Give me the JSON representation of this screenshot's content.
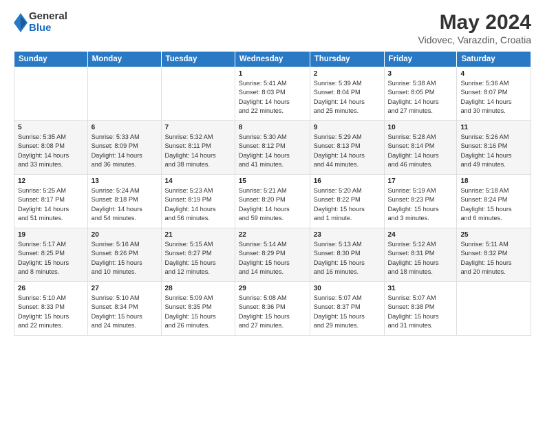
{
  "header": {
    "logo": {
      "general": "General",
      "blue": "Blue"
    },
    "title": "May 2024",
    "subtitle": "Vidovec, Varazdin, Croatia"
  },
  "calendar": {
    "headers": [
      "Sunday",
      "Monday",
      "Tuesday",
      "Wednesday",
      "Thursday",
      "Friday",
      "Saturday"
    ],
    "weeks": [
      [
        {
          "day": "",
          "info": ""
        },
        {
          "day": "",
          "info": ""
        },
        {
          "day": "",
          "info": ""
        },
        {
          "day": "1",
          "info": "Sunrise: 5:41 AM\nSunset: 8:03 PM\nDaylight: 14 hours\nand 22 minutes."
        },
        {
          "day": "2",
          "info": "Sunrise: 5:39 AM\nSunset: 8:04 PM\nDaylight: 14 hours\nand 25 minutes."
        },
        {
          "day": "3",
          "info": "Sunrise: 5:38 AM\nSunset: 8:05 PM\nDaylight: 14 hours\nand 27 minutes."
        },
        {
          "day": "4",
          "info": "Sunrise: 5:36 AM\nSunset: 8:07 PM\nDaylight: 14 hours\nand 30 minutes."
        }
      ],
      [
        {
          "day": "5",
          "info": "Sunrise: 5:35 AM\nSunset: 8:08 PM\nDaylight: 14 hours\nand 33 minutes."
        },
        {
          "day": "6",
          "info": "Sunrise: 5:33 AM\nSunset: 8:09 PM\nDaylight: 14 hours\nand 36 minutes."
        },
        {
          "day": "7",
          "info": "Sunrise: 5:32 AM\nSunset: 8:11 PM\nDaylight: 14 hours\nand 38 minutes."
        },
        {
          "day": "8",
          "info": "Sunrise: 5:30 AM\nSunset: 8:12 PM\nDaylight: 14 hours\nand 41 minutes."
        },
        {
          "day": "9",
          "info": "Sunrise: 5:29 AM\nSunset: 8:13 PM\nDaylight: 14 hours\nand 44 minutes."
        },
        {
          "day": "10",
          "info": "Sunrise: 5:28 AM\nSunset: 8:14 PM\nDaylight: 14 hours\nand 46 minutes."
        },
        {
          "day": "11",
          "info": "Sunrise: 5:26 AM\nSunset: 8:16 PM\nDaylight: 14 hours\nand 49 minutes."
        }
      ],
      [
        {
          "day": "12",
          "info": "Sunrise: 5:25 AM\nSunset: 8:17 PM\nDaylight: 14 hours\nand 51 minutes."
        },
        {
          "day": "13",
          "info": "Sunrise: 5:24 AM\nSunset: 8:18 PM\nDaylight: 14 hours\nand 54 minutes."
        },
        {
          "day": "14",
          "info": "Sunrise: 5:23 AM\nSunset: 8:19 PM\nDaylight: 14 hours\nand 56 minutes."
        },
        {
          "day": "15",
          "info": "Sunrise: 5:21 AM\nSunset: 8:20 PM\nDaylight: 14 hours\nand 59 minutes."
        },
        {
          "day": "16",
          "info": "Sunrise: 5:20 AM\nSunset: 8:22 PM\nDaylight: 15 hours\nand 1 minute."
        },
        {
          "day": "17",
          "info": "Sunrise: 5:19 AM\nSunset: 8:23 PM\nDaylight: 15 hours\nand 3 minutes."
        },
        {
          "day": "18",
          "info": "Sunrise: 5:18 AM\nSunset: 8:24 PM\nDaylight: 15 hours\nand 6 minutes."
        }
      ],
      [
        {
          "day": "19",
          "info": "Sunrise: 5:17 AM\nSunset: 8:25 PM\nDaylight: 15 hours\nand 8 minutes."
        },
        {
          "day": "20",
          "info": "Sunrise: 5:16 AM\nSunset: 8:26 PM\nDaylight: 15 hours\nand 10 minutes."
        },
        {
          "day": "21",
          "info": "Sunrise: 5:15 AM\nSunset: 8:27 PM\nDaylight: 15 hours\nand 12 minutes."
        },
        {
          "day": "22",
          "info": "Sunrise: 5:14 AM\nSunset: 8:29 PM\nDaylight: 15 hours\nand 14 minutes."
        },
        {
          "day": "23",
          "info": "Sunrise: 5:13 AM\nSunset: 8:30 PM\nDaylight: 15 hours\nand 16 minutes."
        },
        {
          "day": "24",
          "info": "Sunrise: 5:12 AM\nSunset: 8:31 PM\nDaylight: 15 hours\nand 18 minutes."
        },
        {
          "day": "25",
          "info": "Sunrise: 5:11 AM\nSunset: 8:32 PM\nDaylight: 15 hours\nand 20 minutes."
        }
      ],
      [
        {
          "day": "26",
          "info": "Sunrise: 5:10 AM\nSunset: 8:33 PM\nDaylight: 15 hours\nand 22 minutes."
        },
        {
          "day": "27",
          "info": "Sunrise: 5:10 AM\nSunset: 8:34 PM\nDaylight: 15 hours\nand 24 minutes."
        },
        {
          "day": "28",
          "info": "Sunrise: 5:09 AM\nSunset: 8:35 PM\nDaylight: 15 hours\nand 26 minutes."
        },
        {
          "day": "29",
          "info": "Sunrise: 5:08 AM\nSunset: 8:36 PM\nDaylight: 15 hours\nand 27 minutes."
        },
        {
          "day": "30",
          "info": "Sunrise: 5:07 AM\nSunset: 8:37 PM\nDaylight: 15 hours\nand 29 minutes."
        },
        {
          "day": "31",
          "info": "Sunrise: 5:07 AM\nSunset: 8:38 PM\nDaylight: 15 hours\nand 31 minutes."
        },
        {
          "day": "",
          "info": ""
        }
      ]
    ]
  }
}
